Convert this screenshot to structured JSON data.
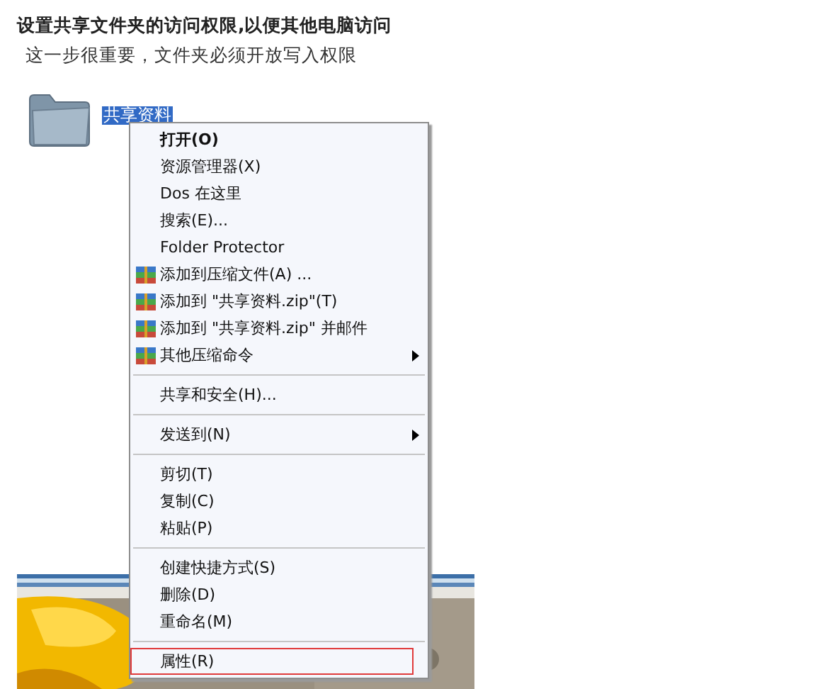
{
  "heading": "设置共享文件夹的访问权限,以便其他电脑访问",
  "subtitle": "这一步很重要，文件夹必须开放写入权限",
  "folder": {
    "label": "共享资料",
    "selected": true
  },
  "context_menu": {
    "items": [
      {
        "kind": "item",
        "label": "打开(O)",
        "default": true,
        "icon": false,
        "submenu": false,
        "highlighted": false
      },
      {
        "kind": "item",
        "label": "资源管理器(X)",
        "default": false,
        "icon": false,
        "submenu": false,
        "highlighted": false
      },
      {
        "kind": "item",
        "label": "Dos 在这里",
        "default": false,
        "icon": false,
        "submenu": false,
        "highlighted": false
      },
      {
        "kind": "item",
        "label": "搜索(E)...",
        "default": false,
        "icon": false,
        "submenu": false,
        "highlighted": false
      },
      {
        "kind": "item",
        "label": "Folder Protector",
        "default": false,
        "icon": false,
        "submenu": false,
        "highlighted": false
      },
      {
        "kind": "item",
        "label": "添加到压缩文件(A) ...",
        "default": false,
        "icon": true,
        "submenu": false,
        "highlighted": false
      },
      {
        "kind": "item",
        "label": "添加到 \"共享资料.zip\"(T)",
        "default": false,
        "icon": true,
        "submenu": false,
        "highlighted": false
      },
      {
        "kind": "item",
        "label": "添加到 \"共享资料.zip\" 并邮件",
        "default": false,
        "icon": true,
        "submenu": false,
        "highlighted": false
      },
      {
        "kind": "item",
        "label": "其他压缩命令",
        "default": false,
        "icon": true,
        "submenu": true,
        "highlighted": false
      },
      {
        "kind": "separator"
      },
      {
        "kind": "item",
        "label": "共享和安全(H)...",
        "default": false,
        "icon": false,
        "submenu": false,
        "highlighted": false
      },
      {
        "kind": "separator"
      },
      {
        "kind": "item",
        "label": "发送到(N)",
        "default": false,
        "icon": false,
        "submenu": true,
        "highlighted": false
      },
      {
        "kind": "separator"
      },
      {
        "kind": "item",
        "label": "剪切(T)",
        "default": false,
        "icon": false,
        "submenu": false,
        "highlighted": false
      },
      {
        "kind": "item",
        "label": "复制(C)",
        "default": false,
        "icon": false,
        "submenu": false,
        "highlighted": false
      },
      {
        "kind": "item",
        "label": "粘贴(P)",
        "default": false,
        "icon": false,
        "submenu": false,
        "highlighted": false
      },
      {
        "kind": "separator"
      },
      {
        "kind": "item",
        "label": "创建快捷方式(S)",
        "default": false,
        "icon": false,
        "submenu": false,
        "highlighted": false
      },
      {
        "kind": "item",
        "label": "删除(D)",
        "default": false,
        "icon": false,
        "submenu": false,
        "highlighted": false
      },
      {
        "kind": "item",
        "label": "重命名(M)",
        "default": false,
        "icon": false,
        "submenu": false,
        "highlighted": false
      },
      {
        "kind": "separator"
      },
      {
        "kind": "item",
        "label": "属性(R)",
        "default": false,
        "icon": false,
        "submenu": false,
        "highlighted": true
      }
    ]
  }
}
